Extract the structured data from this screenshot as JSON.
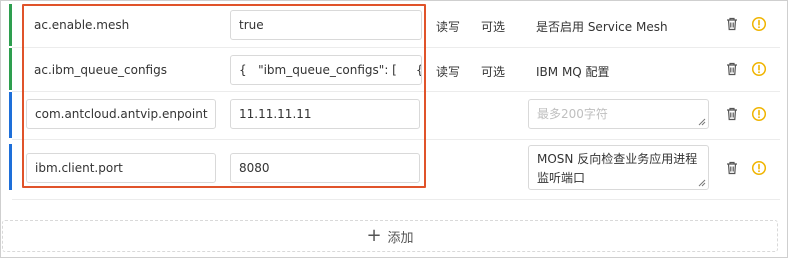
{
  "highlight_color": "#e0532a",
  "rows": [
    {
      "key": "ac.enable.mesh",
      "value": "true",
      "access": "读写",
      "required": "可选",
      "description": "是否启用 Service Mesh",
      "bar_color": "#2e9e4f"
    },
    {
      "key": "ac.ibm_queue_configs",
      "value": "{   \"ibm_queue_configs\": [     {",
      "access": "读写",
      "required": "可选",
      "description": "IBM MQ 配置",
      "bar_color": "#2e9e4f"
    },
    {
      "key": "com.antcloud.antvip.enpoint",
      "value": "11.11.11.11",
      "access": "",
      "required": "",
      "description_placeholder": "最多200字符",
      "bar_color": "#1e6fd9"
    },
    {
      "key": "ibm.client.port",
      "value": "8080",
      "access": "",
      "required": "",
      "description": "MOSN 反向检查业务应用进程监听端口",
      "bar_color": "#1e6fd9"
    }
  ],
  "icons": {
    "delete": "trash-icon",
    "warning": "warning-circle-icon",
    "add": "plus-icon"
  },
  "add_button": {
    "icon": "+",
    "label": "添加"
  }
}
